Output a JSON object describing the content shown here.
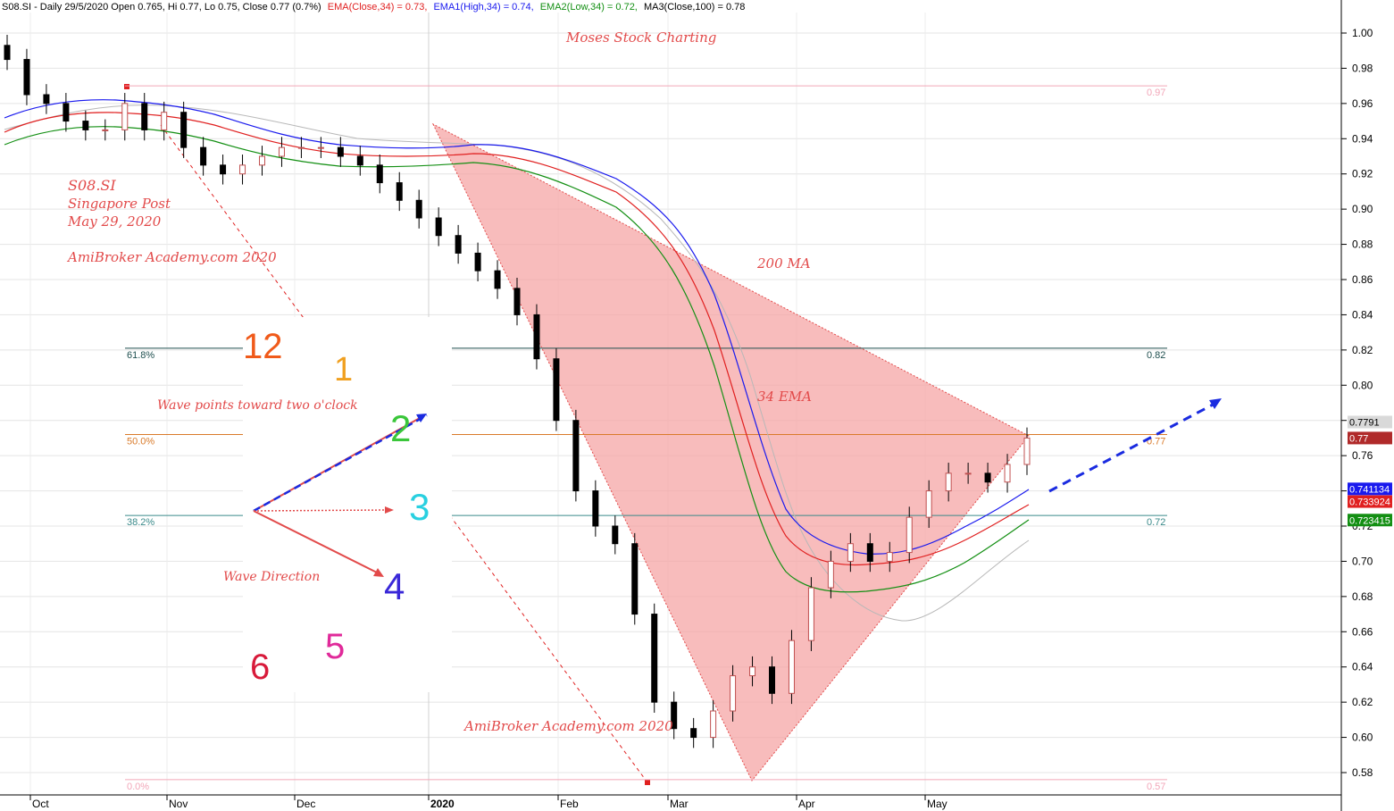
{
  "header": {
    "symbol": "S08.SI - Daily 29/5/2020 Open 0.765, Hi 0.77, Lo 0.75, Close 0.77 (0.7%)",
    "ema": "EMA(Close,34) = 0.73,",
    "ema1": "EMA1(High,34) = 0.74,",
    "ema2": "EMA2(Low,34) = 0.72,",
    "ma3": "MA3(Close,100) = 0.78"
  },
  "colors": {
    "ema": "#e02020",
    "ema1": "#1a1aee",
    "ema2": "#138f13",
    "ma": "#b8b8b8",
    "fill": "#f6a6a6",
    "annot": "#e24a4a",
    "arrow": "#1a2be0"
  },
  "annotations": {
    "title": "Moses Stock Charting",
    "ticker": "S08.SI",
    "company": "Singapore Post",
    "date": "May 29, 2020",
    "brand": "AmiBroker Academy.com  2020",
    "ma_label": "200 MA",
    "ema_label": "34 EMA",
    "wave_points": "Wave points toward two o'clock",
    "wave_direction": "Wave Direction",
    "bottom_brand": "AmiBroker Academy.com 2020"
  },
  "clock": {
    "n12": "12",
    "n1": "1",
    "n2": "2",
    "n3": "3",
    "n4": "4",
    "n5": "5",
    "n6": "6"
  },
  "fib_levels": [
    {
      "pct": "61.8%",
      "price_label": "0.82",
      "price": 0.821,
      "color": "#1f4f4f"
    },
    {
      "pct": "50.0%",
      "price_label": "0.77",
      "price": 0.772,
      "color": "#d97a2a"
    },
    {
      "pct": "38.2%",
      "price_label": "0.72",
      "price": 0.726,
      "color": "#3a8a8a"
    },
    {
      "pct": "",
      "price_label": "0.97",
      "price": 0.97,
      "color": "#f2a6b8"
    },
    {
      "pct": "0.0%",
      "price_label": "0.57",
      "price": 0.576,
      "color": "#f2a6b8"
    }
  ],
  "price_badges": [
    {
      "text": "0.7791",
      "bg": "#d9d9d9",
      "fg": "#000000"
    },
    {
      "text": "0.77",
      "bg": "#b02a2a",
      "fg": "#ffffff"
    },
    {
      "text": "0.741134",
      "bg": "#1a1aee",
      "fg": "#ffffff"
    },
    {
      "text": "0.733924",
      "bg": "#e02020",
      "fg": "#ffffff"
    },
    {
      "text": "0.723415",
      "bg": "#138f13",
      "fg": "#ffffff"
    }
  ],
  "chart_data": {
    "type": "candlestick",
    "title": "S08.SI - Daily 29/5/2020",
    "ylim": [
      0.57,
      1.005
    ],
    "y_ticks": [
      "1.00",
      "0.98",
      "0.96",
      "0.94",
      "0.92",
      "0.90",
      "0.88",
      "0.86",
      "0.84",
      "0.82",
      "0.80",
      "0.78",
      "0.76",
      "0.74",
      "0.72",
      "0.70",
      "0.68",
      "0.66",
      "0.64",
      "0.62",
      "0.60",
      "0.58"
    ],
    "x_labels": [
      "Oct",
      "Nov",
      "Dec",
      "2020",
      "Feb",
      "Mar",
      "Apr",
      "May"
    ],
    "grid": true,
    "series_close_approx": [
      0.985,
      0.965,
      0.96,
      0.95,
      0.945,
      0.945,
      0.96,
      0.945,
      0.955,
      0.935,
      0.925,
      0.92,
      0.925,
      0.93,
      0.935,
      0.935,
      0.935,
      0.93,
      0.925,
      0.915,
      0.905,
      0.895,
      0.885,
      0.875,
      0.865,
      0.855,
      0.84,
      0.815,
      0.78,
      0.74,
      0.72,
      0.71,
      0.67,
      0.62,
      0.605,
      0.6,
      0.615,
      0.635,
      0.64,
      0.625,
      0.655,
      0.685,
      0.7,
      0.71,
      0.7,
      0.705,
      0.725,
      0.74,
      0.75,
      0.75,
      0.745,
      0.755,
      0.77
    ],
    "ema_close_34_last": 0.733924,
    "ema_high_34_last": 0.741134,
    "ema_low_34_last": 0.723415,
    "ma_close_100_last": 0.7791
  }
}
